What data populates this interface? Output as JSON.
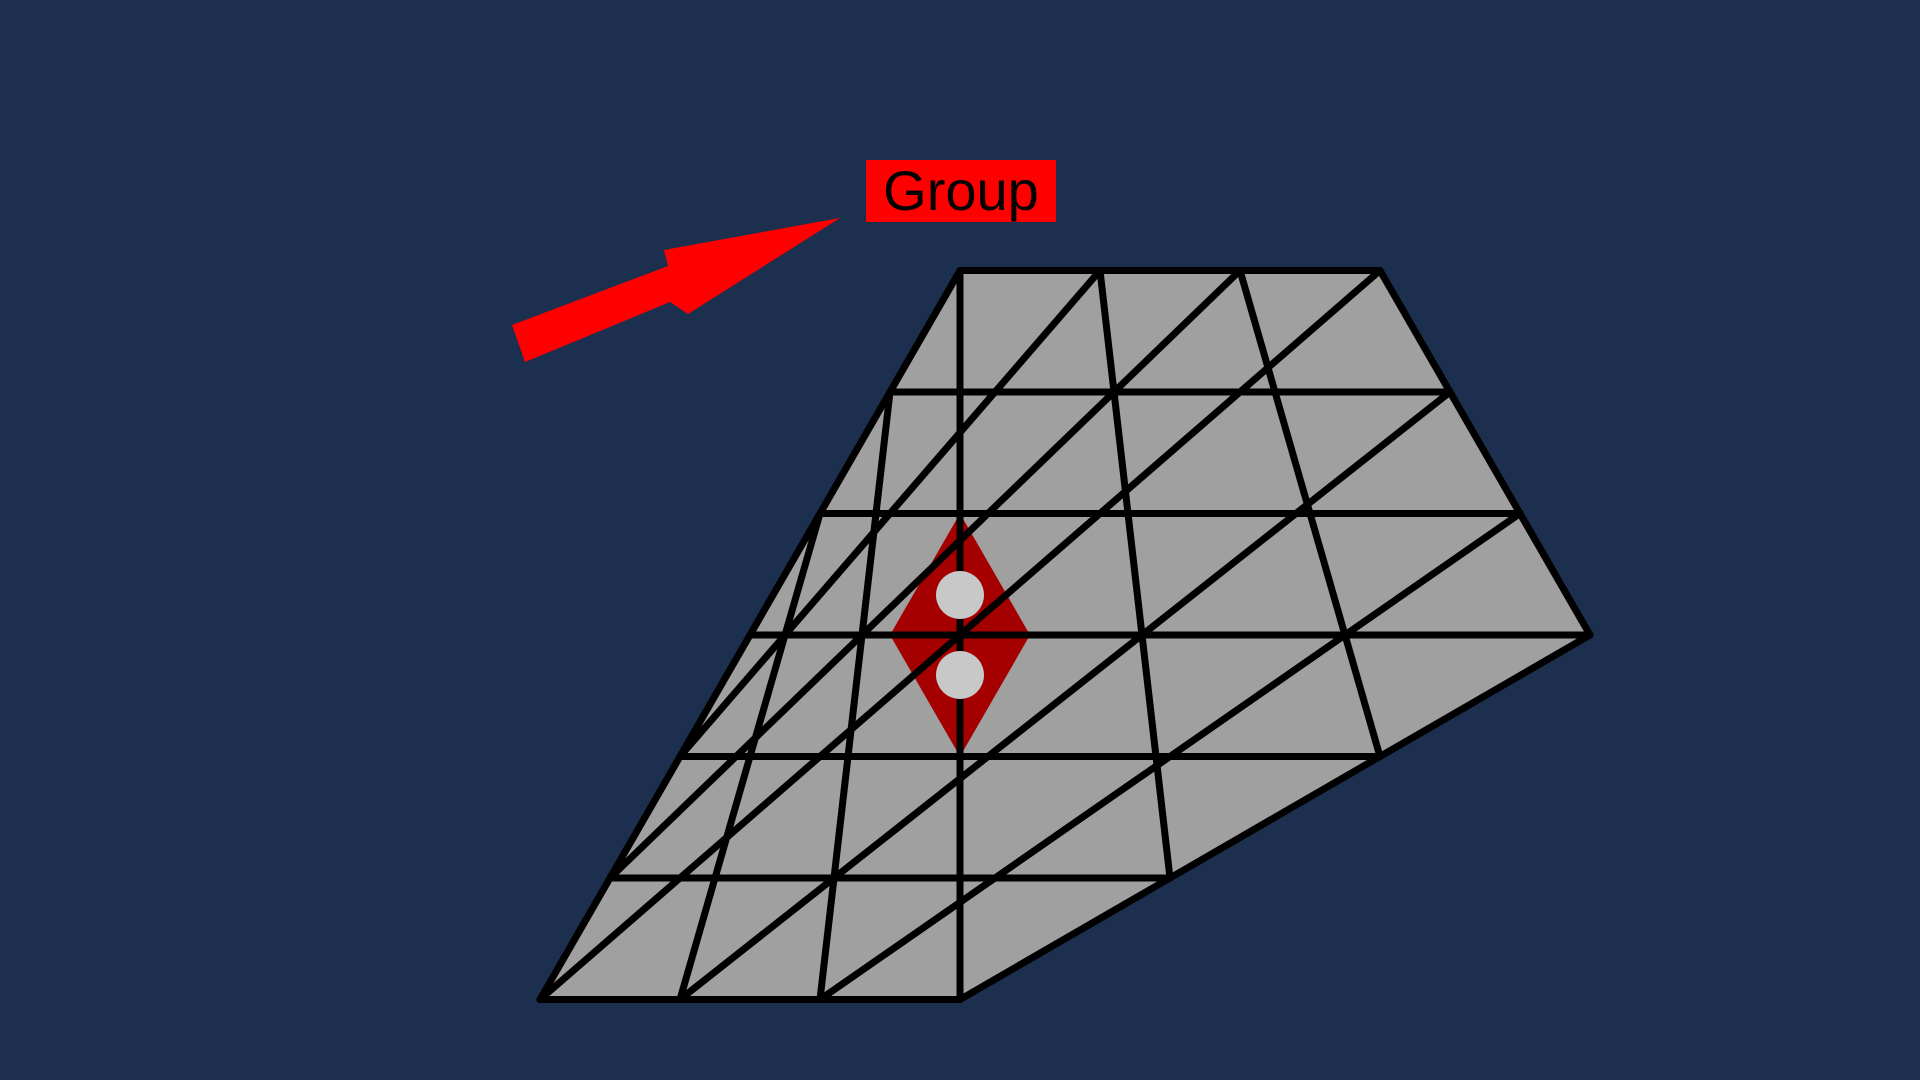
{
  "colors": {
    "background": "#1d2f4e",
    "cell_fill": "#a0a0a0",
    "grid_line": "#000000",
    "highlight_fill": "#a50000",
    "marker_fill": "#c8c8c8",
    "label_bg": "#ff0000",
    "arrow": "#ff0000"
  },
  "label": {
    "text": "Group",
    "icon": "arrow-icon"
  },
  "board": {
    "shape": "hexagon",
    "side_length": 3,
    "highlighted_group": {
      "cells": 2,
      "markers": 2
    }
  }
}
